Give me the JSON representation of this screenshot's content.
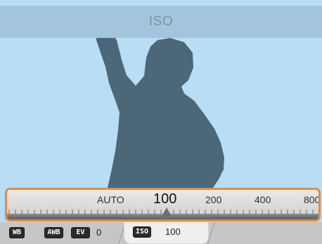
{
  "header": {
    "title": "ISO"
  },
  "iso_scale": {
    "values": [
      "AUTO",
      "100",
      "200",
      "400",
      "800"
    ],
    "selected": "100",
    "accent_color": "#e88a37"
  },
  "status_bar": {
    "wb_label": "WB",
    "awb_label": "AWB",
    "ev_label": "EV",
    "ev_value": "0",
    "iso_label": "ISO",
    "iso_value": "100"
  },
  "scene": {
    "background_color": "#b9ddf4",
    "silhouette_color": "#4b6778"
  }
}
